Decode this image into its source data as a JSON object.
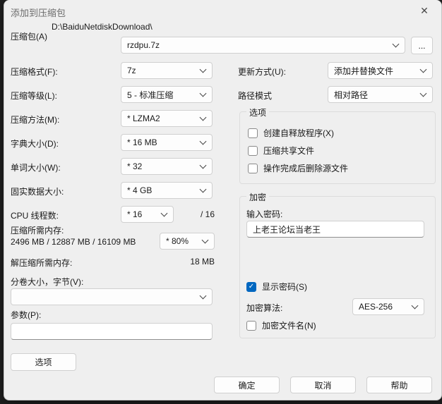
{
  "window": {
    "title": "添加到压缩包"
  },
  "icons": {
    "close": "✕",
    "check": "✓",
    "ellipsis": "..."
  },
  "colors": {
    "accent": "#0067c0",
    "dialog_bg": "#efefef",
    "control_bg": "#fdfdfd"
  },
  "archive": {
    "label": "压缩包(A)",
    "dir_path": "D:\\BaiduNetdiskDownload\\",
    "filename": "rzdpu.7z"
  },
  "left_fields": [
    {
      "label": "压缩格式(F):",
      "value": "7z"
    },
    {
      "label": "压缩等级(L):",
      "value": "5 - 标准压缩"
    },
    {
      "label": "压缩方法(M):",
      "value": "* LZMA2"
    },
    {
      "label": "字典大小(D):",
      "value": "* 16 MB"
    },
    {
      "label": "单词大小(W):",
      "value": "* 32"
    },
    {
      "label": "固实数据大小:",
      "value": "* 4 GB"
    }
  ],
  "cpu": {
    "label": "CPU 线程数:",
    "value": "* 16",
    "suffix": "/ 16"
  },
  "memory": {
    "label": "压缩所需内存:",
    "detail": "2496 MB / 12887 MB / 16109 MB",
    "value": "* 80%"
  },
  "decompress_memory": {
    "label": "解压缩所需内存:",
    "value": "18 MB"
  },
  "volume": {
    "label": "分卷大小，字节(V):",
    "value": ""
  },
  "parameters": {
    "label": "参数(P):",
    "value": ""
  },
  "options_button_label": "选项",
  "update_mode": {
    "label": "更新方式(U):",
    "value": "添加并替换文件"
  },
  "path_mode": {
    "label": "路径模式",
    "value": "相对路径"
  },
  "options_group": {
    "title": "选项",
    "checkboxes": [
      {
        "label": "创建自释放程序(X)",
        "checked": false
      },
      {
        "label": "压缩共享文件",
        "checked": false
      },
      {
        "label": "操作完成后删除源文件",
        "checked": false
      }
    ]
  },
  "encryption_group": {
    "title": "加密",
    "password_label": "输入密码:",
    "password_value": "上老王论坛当老王",
    "show_password": {
      "label": "显示密码(S)",
      "checked": true
    },
    "method": {
      "label": "加密算法:",
      "value": "AES-256"
    },
    "encrypt_names": {
      "label": "加密文件名(N)",
      "checked": false
    }
  },
  "footer_buttons": [
    {
      "label": "确定"
    },
    {
      "label": "取消"
    },
    {
      "label": "帮助"
    }
  ]
}
